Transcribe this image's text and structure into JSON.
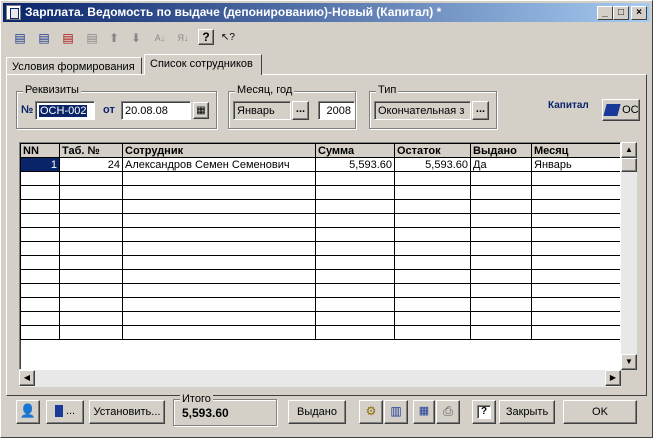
{
  "window": {
    "title": "Зарплата. Ведомость по выдаче (депонированию)-Новый (Капитал) *",
    "controls": [
      "_",
      "□",
      "×"
    ]
  },
  "toolbar": {
    "icons": [
      "new-row-icon",
      "copy-row-icon",
      "delete-row-icon",
      "edit-row-icon",
      "move-up-icon",
      "move-down-icon",
      "sort-asc-icon",
      "sort-desc-icon",
      "help-icon",
      "whats-this-icon"
    ],
    "glyphs": [
      "▤",
      "▤",
      "▤",
      "▤",
      "⬆",
      "⬇",
      "A↓",
      "Я↓",
      "?",
      "↖?"
    ]
  },
  "tabs": [
    {
      "label": "Условия формирования",
      "active": false
    },
    {
      "label": "Список сотрудников",
      "active": true
    }
  ],
  "requisites": {
    "group_label": "Реквизиты",
    "number_label": "№",
    "number_value": "ОСН-002",
    "date_label": "от",
    "date_value": "20.08.08"
  },
  "period": {
    "group_label": "Месяц, год",
    "month_value": "Январь",
    "year_value": "2008",
    "ellipsis": "..."
  },
  "type": {
    "group_label": "Тип",
    "value": "Окончательная з",
    "ellipsis": "..."
  },
  "org": {
    "label": "Капитал",
    "button_text": "ОСН"
  },
  "table": {
    "columns": [
      "NN",
      "Таб. №",
      "Сотрудник",
      "Сумма",
      "Остаток",
      "Выдано",
      "Месяц"
    ],
    "rows": [
      {
        "nn": "1",
        "tab": "24",
        "employee": "Александров Семен Семенович",
        "sum": "5,593.60",
        "rest": "5,593.60",
        "issued": "Да",
        "month": "Январь"
      }
    ]
  },
  "bottom": {
    "more_label": "...",
    "set_button": "Установить...",
    "total_label": "Итого",
    "total_value": "5,593.60",
    "issued_button": "Выдано",
    "close_button": "Закрыть",
    "ok_button": "OK",
    "help_glyph": "?"
  }
}
